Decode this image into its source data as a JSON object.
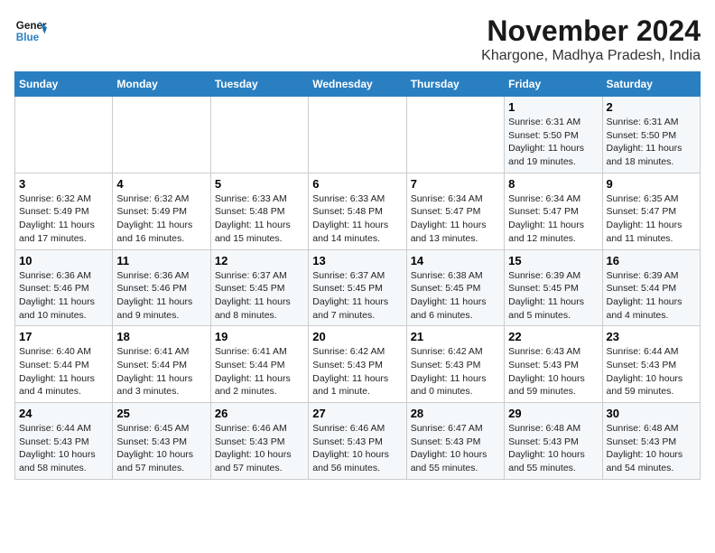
{
  "logo": {
    "line1": "General",
    "line2": "Blue"
  },
  "title": "November 2024",
  "subtitle": "Khargone, Madhya Pradesh, India",
  "days_of_week": [
    "Sunday",
    "Monday",
    "Tuesday",
    "Wednesday",
    "Thursday",
    "Friday",
    "Saturday"
  ],
  "weeks": [
    [
      {
        "num": "",
        "info": ""
      },
      {
        "num": "",
        "info": ""
      },
      {
        "num": "",
        "info": ""
      },
      {
        "num": "",
        "info": ""
      },
      {
        "num": "",
        "info": ""
      },
      {
        "num": "1",
        "info": "Sunrise: 6:31 AM\nSunset: 5:50 PM\nDaylight: 11 hours and 19 minutes."
      },
      {
        "num": "2",
        "info": "Sunrise: 6:31 AM\nSunset: 5:50 PM\nDaylight: 11 hours and 18 minutes."
      }
    ],
    [
      {
        "num": "3",
        "info": "Sunrise: 6:32 AM\nSunset: 5:49 PM\nDaylight: 11 hours and 17 minutes."
      },
      {
        "num": "4",
        "info": "Sunrise: 6:32 AM\nSunset: 5:49 PM\nDaylight: 11 hours and 16 minutes."
      },
      {
        "num": "5",
        "info": "Sunrise: 6:33 AM\nSunset: 5:48 PM\nDaylight: 11 hours and 15 minutes."
      },
      {
        "num": "6",
        "info": "Sunrise: 6:33 AM\nSunset: 5:48 PM\nDaylight: 11 hours and 14 minutes."
      },
      {
        "num": "7",
        "info": "Sunrise: 6:34 AM\nSunset: 5:47 PM\nDaylight: 11 hours and 13 minutes."
      },
      {
        "num": "8",
        "info": "Sunrise: 6:34 AM\nSunset: 5:47 PM\nDaylight: 11 hours and 12 minutes."
      },
      {
        "num": "9",
        "info": "Sunrise: 6:35 AM\nSunset: 5:47 PM\nDaylight: 11 hours and 11 minutes."
      }
    ],
    [
      {
        "num": "10",
        "info": "Sunrise: 6:36 AM\nSunset: 5:46 PM\nDaylight: 11 hours and 10 minutes."
      },
      {
        "num": "11",
        "info": "Sunrise: 6:36 AM\nSunset: 5:46 PM\nDaylight: 11 hours and 9 minutes."
      },
      {
        "num": "12",
        "info": "Sunrise: 6:37 AM\nSunset: 5:45 PM\nDaylight: 11 hours and 8 minutes."
      },
      {
        "num": "13",
        "info": "Sunrise: 6:37 AM\nSunset: 5:45 PM\nDaylight: 11 hours and 7 minutes."
      },
      {
        "num": "14",
        "info": "Sunrise: 6:38 AM\nSunset: 5:45 PM\nDaylight: 11 hours and 6 minutes."
      },
      {
        "num": "15",
        "info": "Sunrise: 6:39 AM\nSunset: 5:45 PM\nDaylight: 11 hours and 5 minutes."
      },
      {
        "num": "16",
        "info": "Sunrise: 6:39 AM\nSunset: 5:44 PM\nDaylight: 11 hours and 4 minutes."
      }
    ],
    [
      {
        "num": "17",
        "info": "Sunrise: 6:40 AM\nSunset: 5:44 PM\nDaylight: 11 hours and 4 minutes."
      },
      {
        "num": "18",
        "info": "Sunrise: 6:41 AM\nSunset: 5:44 PM\nDaylight: 11 hours and 3 minutes."
      },
      {
        "num": "19",
        "info": "Sunrise: 6:41 AM\nSunset: 5:44 PM\nDaylight: 11 hours and 2 minutes."
      },
      {
        "num": "20",
        "info": "Sunrise: 6:42 AM\nSunset: 5:43 PM\nDaylight: 11 hours and 1 minute."
      },
      {
        "num": "21",
        "info": "Sunrise: 6:42 AM\nSunset: 5:43 PM\nDaylight: 11 hours and 0 minutes."
      },
      {
        "num": "22",
        "info": "Sunrise: 6:43 AM\nSunset: 5:43 PM\nDaylight: 10 hours and 59 minutes."
      },
      {
        "num": "23",
        "info": "Sunrise: 6:44 AM\nSunset: 5:43 PM\nDaylight: 10 hours and 59 minutes."
      }
    ],
    [
      {
        "num": "24",
        "info": "Sunrise: 6:44 AM\nSunset: 5:43 PM\nDaylight: 10 hours and 58 minutes."
      },
      {
        "num": "25",
        "info": "Sunrise: 6:45 AM\nSunset: 5:43 PM\nDaylight: 10 hours and 57 minutes."
      },
      {
        "num": "26",
        "info": "Sunrise: 6:46 AM\nSunset: 5:43 PM\nDaylight: 10 hours and 57 minutes."
      },
      {
        "num": "27",
        "info": "Sunrise: 6:46 AM\nSunset: 5:43 PM\nDaylight: 10 hours and 56 minutes."
      },
      {
        "num": "28",
        "info": "Sunrise: 6:47 AM\nSunset: 5:43 PM\nDaylight: 10 hours and 55 minutes."
      },
      {
        "num": "29",
        "info": "Sunrise: 6:48 AM\nSunset: 5:43 PM\nDaylight: 10 hours and 55 minutes."
      },
      {
        "num": "30",
        "info": "Sunrise: 6:48 AM\nSunset: 5:43 PM\nDaylight: 10 hours and 54 minutes."
      }
    ]
  ]
}
